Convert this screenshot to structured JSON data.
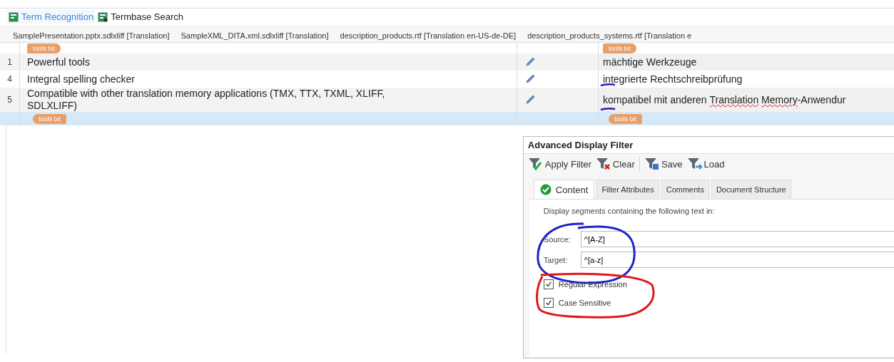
{
  "panel_tabs": [
    {
      "label": "Term Recognition",
      "selected": true
    },
    {
      "label": "Termbase Search",
      "selected": false
    }
  ],
  "document_tabs": [
    "SamplePresentation.pptx.sdlxliff [Translation]",
    "SampleXML_DITA.xml.sdlxliff [Translation]",
    "description_products.rtf [Translation en-US-de-DE]",
    "description_products_systems.rtf [Translation e"
  ],
  "rows": [
    {
      "kind": "tag_start",
      "selected": false,
      "source_tag": "tools txt",
      "target_tag": "tools txt"
    },
    {
      "kind": "segment",
      "selected": false,
      "number": "1",
      "source": "Powerful tools",
      "edited": true,
      "target": [
        {
          "text": "mächtige Werkzeuge",
          "misspelled": false
        }
      ]
    },
    {
      "kind": "segment",
      "selected": false,
      "number": "4",
      "source": "Integral spelling checker",
      "edited": true,
      "target": [
        {
          "text": "integrierte Rechtschreibprüfung",
          "misspelled": false
        }
      ]
    },
    {
      "kind": "segment",
      "selected": false,
      "number": "5",
      "source": "Compatible with other translation memory applications (TMX, TTX, TXML, XLIFF, SDLXLIFF)",
      "edited": true,
      "target": [
        {
          "text": "kompatibel mit anderen",
          "misspelled": false
        },
        {
          "text": "Translation",
          "misspelled": true
        },
        {
          "text": "Memory",
          "misspelled": true
        },
        {
          "text": "-Anwendur",
          "misspelled": false,
          "joined": true
        }
      ]
    },
    {
      "kind": "tag_end",
      "selected": true,
      "source_tag": "tools txt",
      "target_tag": "tools txt"
    }
  ],
  "filter": {
    "title": "Advanced Display Filter",
    "toolbar": [
      {
        "kind": "apply",
        "label": "Apply Filter"
      },
      {
        "kind": "clear",
        "label": "Clear"
      },
      {
        "kind": "separator"
      },
      {
        "kind": "save",
        "label": "Save"
      },
      {
        "kind": "load",
        "label": "Load"
      }
    ],
    "tabs": [
      {
        "label": "Content",
        "selected": true
      },
      {
        "label": "Filter Attributes",
        "selected": false
      },
      {
        "label": "Comments",
        "selected": false
      },
      {
        "label": "Document Structure",
        "selected": false
      }
    ],
    "description": "Display segments containing the following text in:",
    "fields": [
      {
        "label": "Source:",
        "value": "^[A-Z]"
      },
      {
        "label": "Target:",
        "value": "^[a-z]"
      }
    ],
    "options": [
      {
        "label": "Regular Expression",
        "checked": true
      },
      {
        "label": "Case Sensitive",
        "checked": true
      }
    ]
  }
}
